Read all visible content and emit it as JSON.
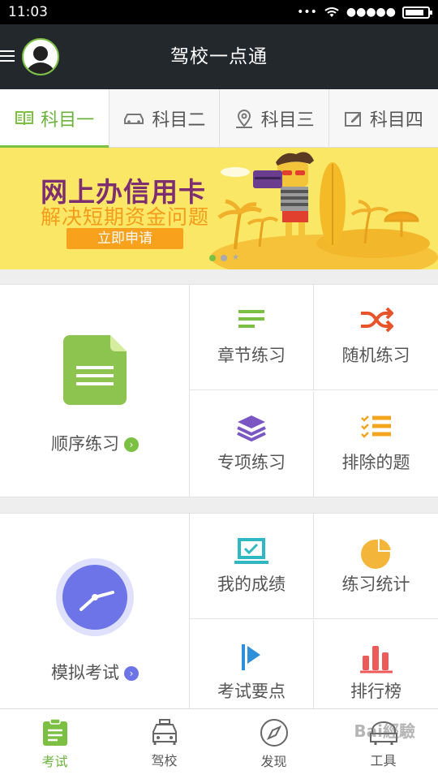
{
  "status": {
    "time": "11:03",
    "signal": "•••",
    "cell": "●●●●●"
  },
  "header": {
    "title": "驾校一点通"
  },
  "tabs": [
    {
      "label": "科目一",
      "icon": "book-icon"
    },
    {
      "label": "科目二",
      "icon": "car-icon"
    },
    {
      "label": "科目三",
      "icon": "map-pin-icon"
    },
    {
      "label": "科目四",
      "icon": "edit-icon"
    }
  ],
  "banner": {
    "title": "网上办信用卡",
    "subtitle": "解决短期资金问题",
    "button": "立即申请"
  },
  "practice": {
    "main_label": "顺序练习",
    "items": [
      {
        "label": "章节练习",
        "icon": "list-icon"
      },
      {
        "label": "随机练习",
        "icon": "shuffle-icon"
      },
      {
        "label": "专项练习",
        "icon": "layers-icon"
      },
      {
        "label": "排除的题",
        "icon": "checklist-icon"
      }
    ]
  },
  "exam": {
    "main_label": "模拟考试",
    "items": [
      {
        "label": "我的成绩",
        "icon": "laptop-check-icon"
      },
      {
        "label": "练习统计",
        "icon": "pie-chart-icon"
      },
      {
        "label": "考试要点",
        "icon": "flag-icon"
      },
      {
        "label": "排行榜",
        "icon": "bar-chart-icon"
      }
    ]
  },
  "bottom_nav": [
    {
      "label": "考试",
      "icon": "clipboard-icon"
    },
    {
      "label": "驾校",
      "icon": "taxi-icon"
    },
    {
      "label": "发现",
      "icon": "compass-icon"
    },
    {
      "label": "工具",
      "icon": "tools-icon"
    }
  ],
  "watermark": "Bai經驗",
  "colors": {
    "green": "#7bc043",
    "dark": "#23282d",
    "orange": "#f7a11c",
    "purple": "#7d2e70",
    "clock": "#6d74e8"
  }
}
